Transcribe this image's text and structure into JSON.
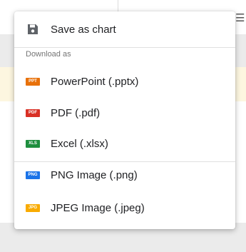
{
  "menu": {
    "save_label": "Save as chart",
    "section_label": "Download as",
    "items": [
      {
        "label": "PowerPoint (.pptx)",
        "badge": "PPT",
        "color": "#e8710a"
      },
      {
        "label": "PDF (.pdf)",
        "badge": "PDF",
        "color": "#d93025"
      },
      {
        "label": "Excel (.xlsx)",
        "badge": "XLS",
        "color": "#1e8e3e"
      },
      {
        "label": "PNG Image (.png)",
        "badge": "PNG",
        "color": "#1a73e8"
      },
      {
        "label": "JPEG Image (.jpeg)",
        "badge": "JPG",
        "color": "#f9ab00"
      }
    ]
  }
}
